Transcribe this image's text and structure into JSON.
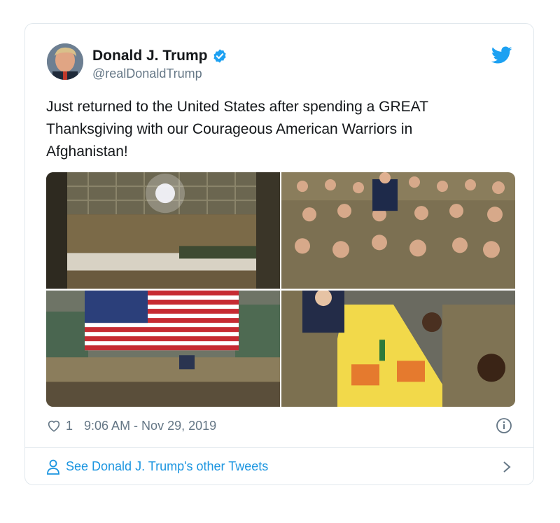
{
  "tweet": {
    "author_name": "Donald J. Trump",
    "author_handle": "@realDonaldTrump",
    "text": "Just returned to the United States after spending a GREAT Thanksgiving with our Courageous American Warriors in Afghanistan!",
    "likes": "1",
    "timestamp": "9:06 AM - Nov 29, 2019",
    "footer_link": "See Donald J. Trump's other Tweets"
  },
  "icons": {
    "verified": "verified-badge-icon",
    "brand": "twitter-bird-icon",
    "like": "heart-icon",
    "info": "info-icon",
    "profile": "person-icon",
    "more": "chevron-right-icon"
  },
  "colors": {
    "brand_blue": "#1da1f2",
    "link_blue": "#1b95e0",
    "secondary_text": "#657786",
    "border": "#e1e8ed"
  }
}
